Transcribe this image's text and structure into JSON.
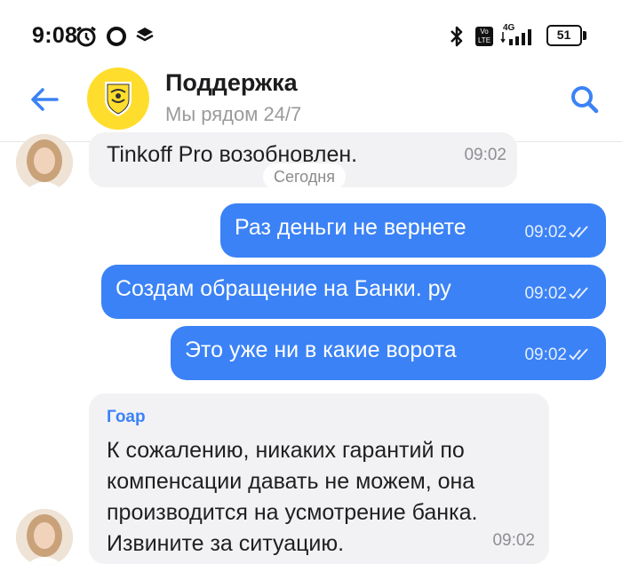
{
  "status_bar": {
    "time": "9:08",
    "lte_label": "Vo LTE",
    "network": "4G",
    "battery": "51"
  },
  "header": {
    "title": "Поддержка",
    "subtitle": "Мы рядом 24/7"
  },
  "date_separator": "Сегодня",
  "messages": [
    {
      "direction": "in",
      "text": "Tinkoff Pro возобновлен.",
      "time": "09:02"
    },
    {
      "direction": "out",
      "text": "Раз деньги не вернете",
      "time": "09:02"
    },
    {
      "direction": "out",
      "text": "Создам обращение на Банки. ру",
      "time": "09:02"
    },
    {
      "direction": "out",
      "text": "Это уже ни в какие ворота",
      "time": "09:02"
    },
    {
      "direction": "in",
      "sender": "Гоар",
      "lines": [
        "К сожалению, никаких гарантий по",
        "компенсации давать не можем, она",
        "производится на усмотрение банка.",
        "Извините за ситуацию."
      ],
      "time": "09:02"
    }
  ],
  "colors": {
    "accent": "#3b82f6",
    "incoming_bubble": "#f2f2f5",
    "brand_yellow": "#ffdd2d"
  },
  "icons": {
    "back": "arrow-left-icon",
    "search": "magnifier-icon",
    "read_receipt": "double-check-icon"
  }
}
